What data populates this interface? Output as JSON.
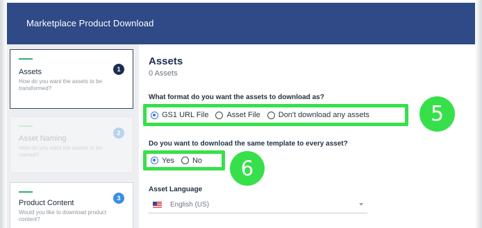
{
  "window": {
    "title": "Marketplace Product Download"
  },
  "sidebar": {
    "steps": [
      {
        "number": "1",
        "title": "Assets",
        "description": "How do you want the assets to be transformed?",
        "state": "active"
      },
      {
        "number": "2",
        "title": "Asset Naming",
        "description": "How do you want the assets to be named?",
        "state": "disabled"
      },
      {
        "number": "3",
        "title": "Product Content",
        "description": "Would you like to download product content?",
        "state": "pending"
      }
    ]
  },
  "main": {
    "title": "Assets",
    "subtitle": "0 Assets",
    "format_question": "What format do you want the assets to download as?",
    "format_options": [
      {
        "label": "GS1 URL File",
        "selected": true
      },
      {
        "label": "Asset File",
        "selected": false
      },
      {
        "label": "Don't download any assets",
        "selected": false
      }
    ],
    "template_question": "Do you want to download the same template to every asset?",
    "template_options": [
      {
        "label": "Yes",
        "selected": true
      },
      {
        "label": "No",
        "selected": false
      }
    ],
    "language_label": "Asset Language",
    "language_value": "English (US)",
    "language_flag": "us-flag"
  },
  "callouts": [
    "5",
    "6"
  ],
  "colors": {
    "header": "#2f4a86",
    "highlight": "#37e04a",
    "step_accent": "#28b36a",
    "radio_selected": "#3a78c9",
    "step_badge": "#1c2f52",
    "step_badge_disabled": "#b7d3ee",
    "step_badge_pending": "#3a8fe0"
  }
}
